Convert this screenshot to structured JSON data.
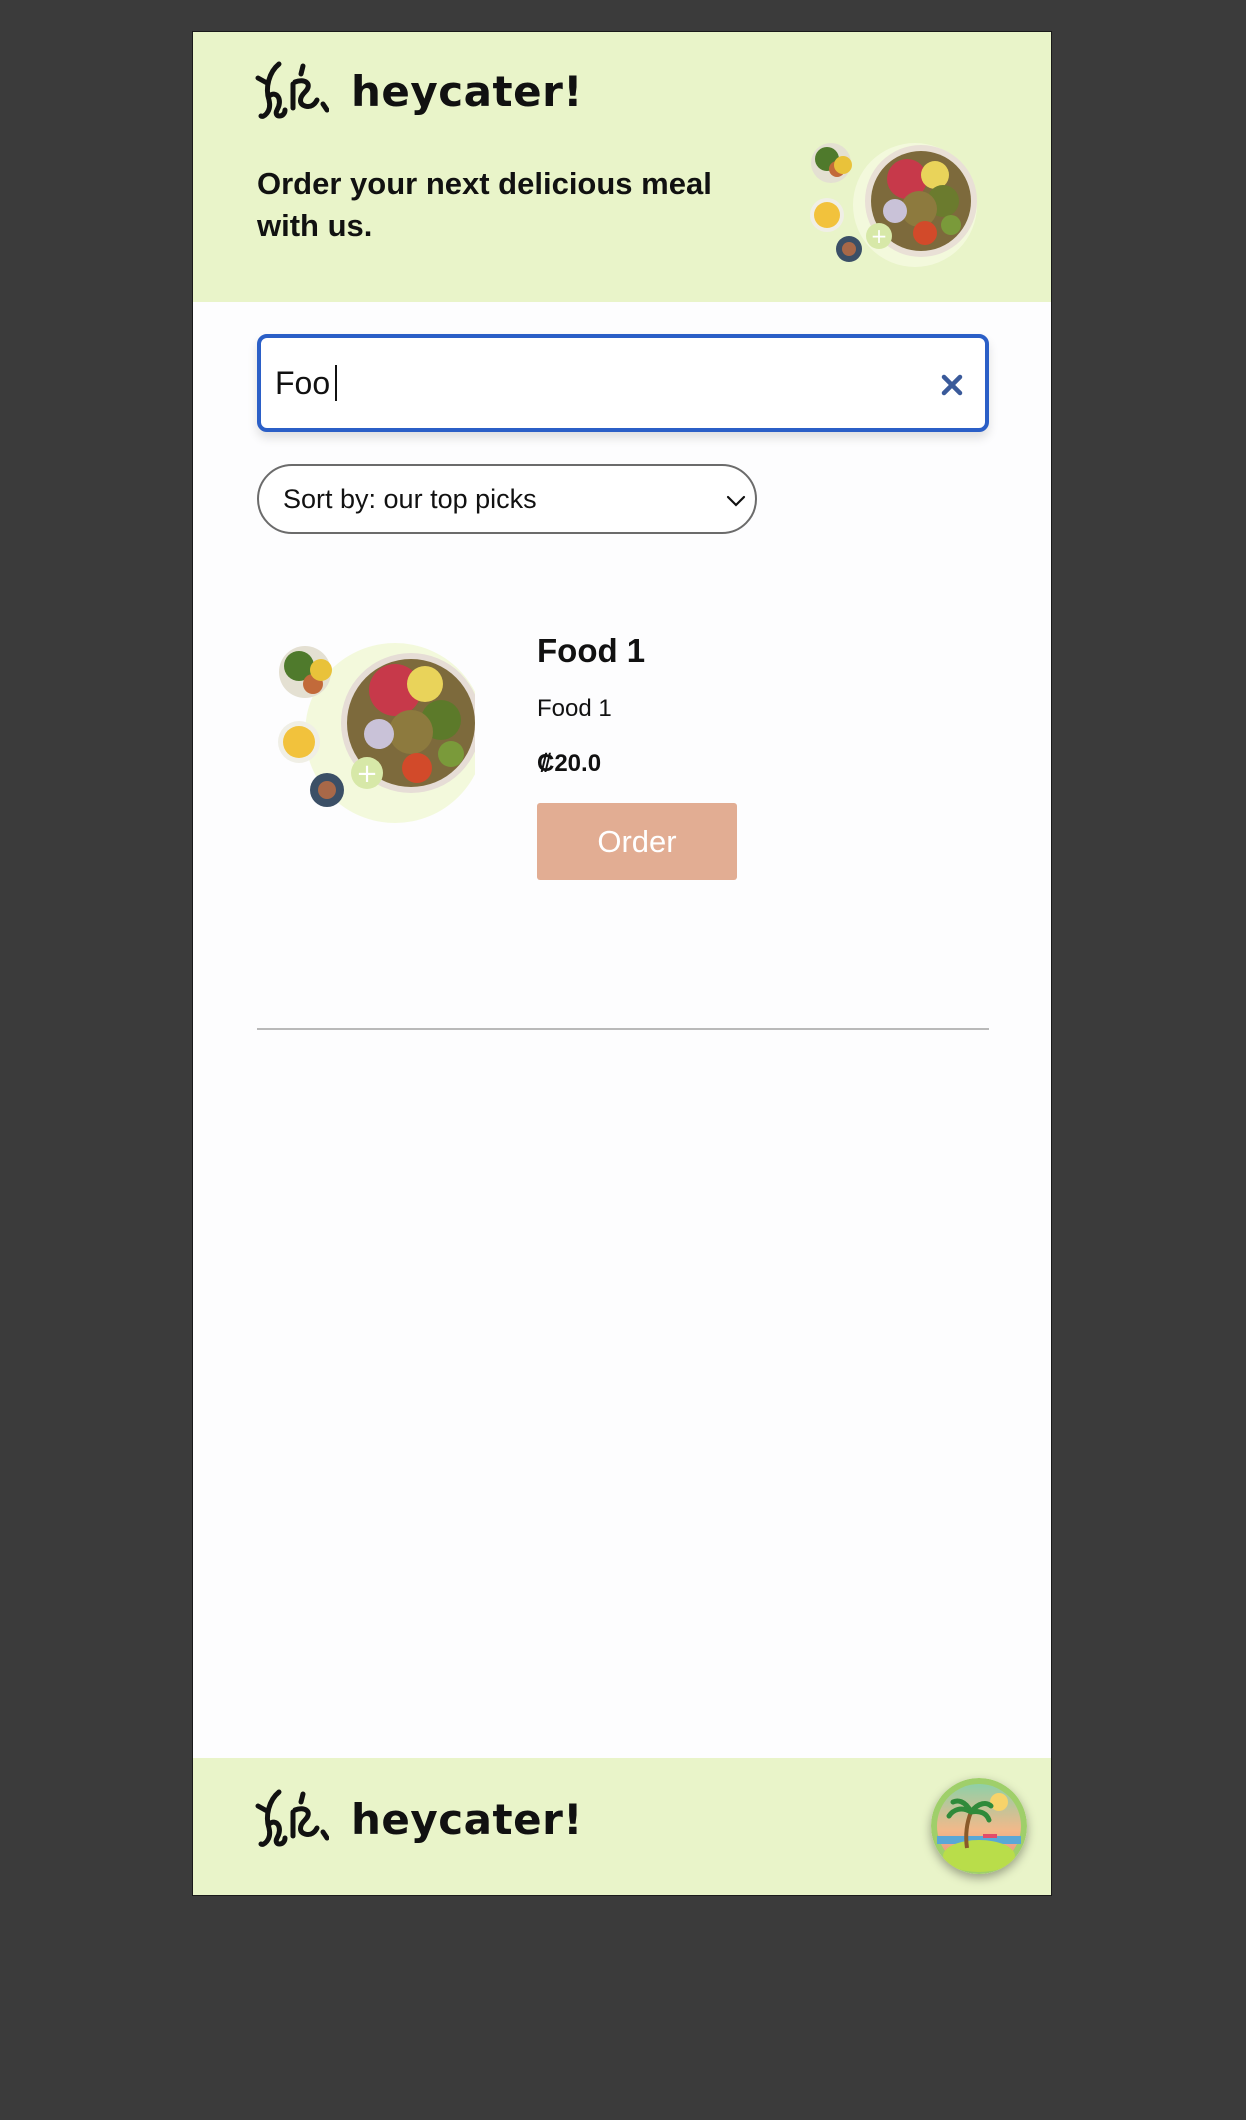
{
  "header": {
    "brand": "heycater!",
    "tagline": "Order your next delicious meal with us."
  },
  "search": {
    "value": "Foo",
    "clear_icon": "close-icon"
  },
  "sort": {
    "label": "Sort by: our top picks"
  },
  "results": [
    {
      "title": "Food 1",
      "description": "Food 1",
      "price": "₡20.0",
      "order_label": "Order"
    }
  ],
  "footer": {
    "brand": "heycater!"
  },
  "colors": {
    "header_bg": "#e9f4c9",
    "search_border": "#2b5fc7",
    "order_button": "#e2ad93",
    "page_bg": "#3b3b3b"
  }
}
